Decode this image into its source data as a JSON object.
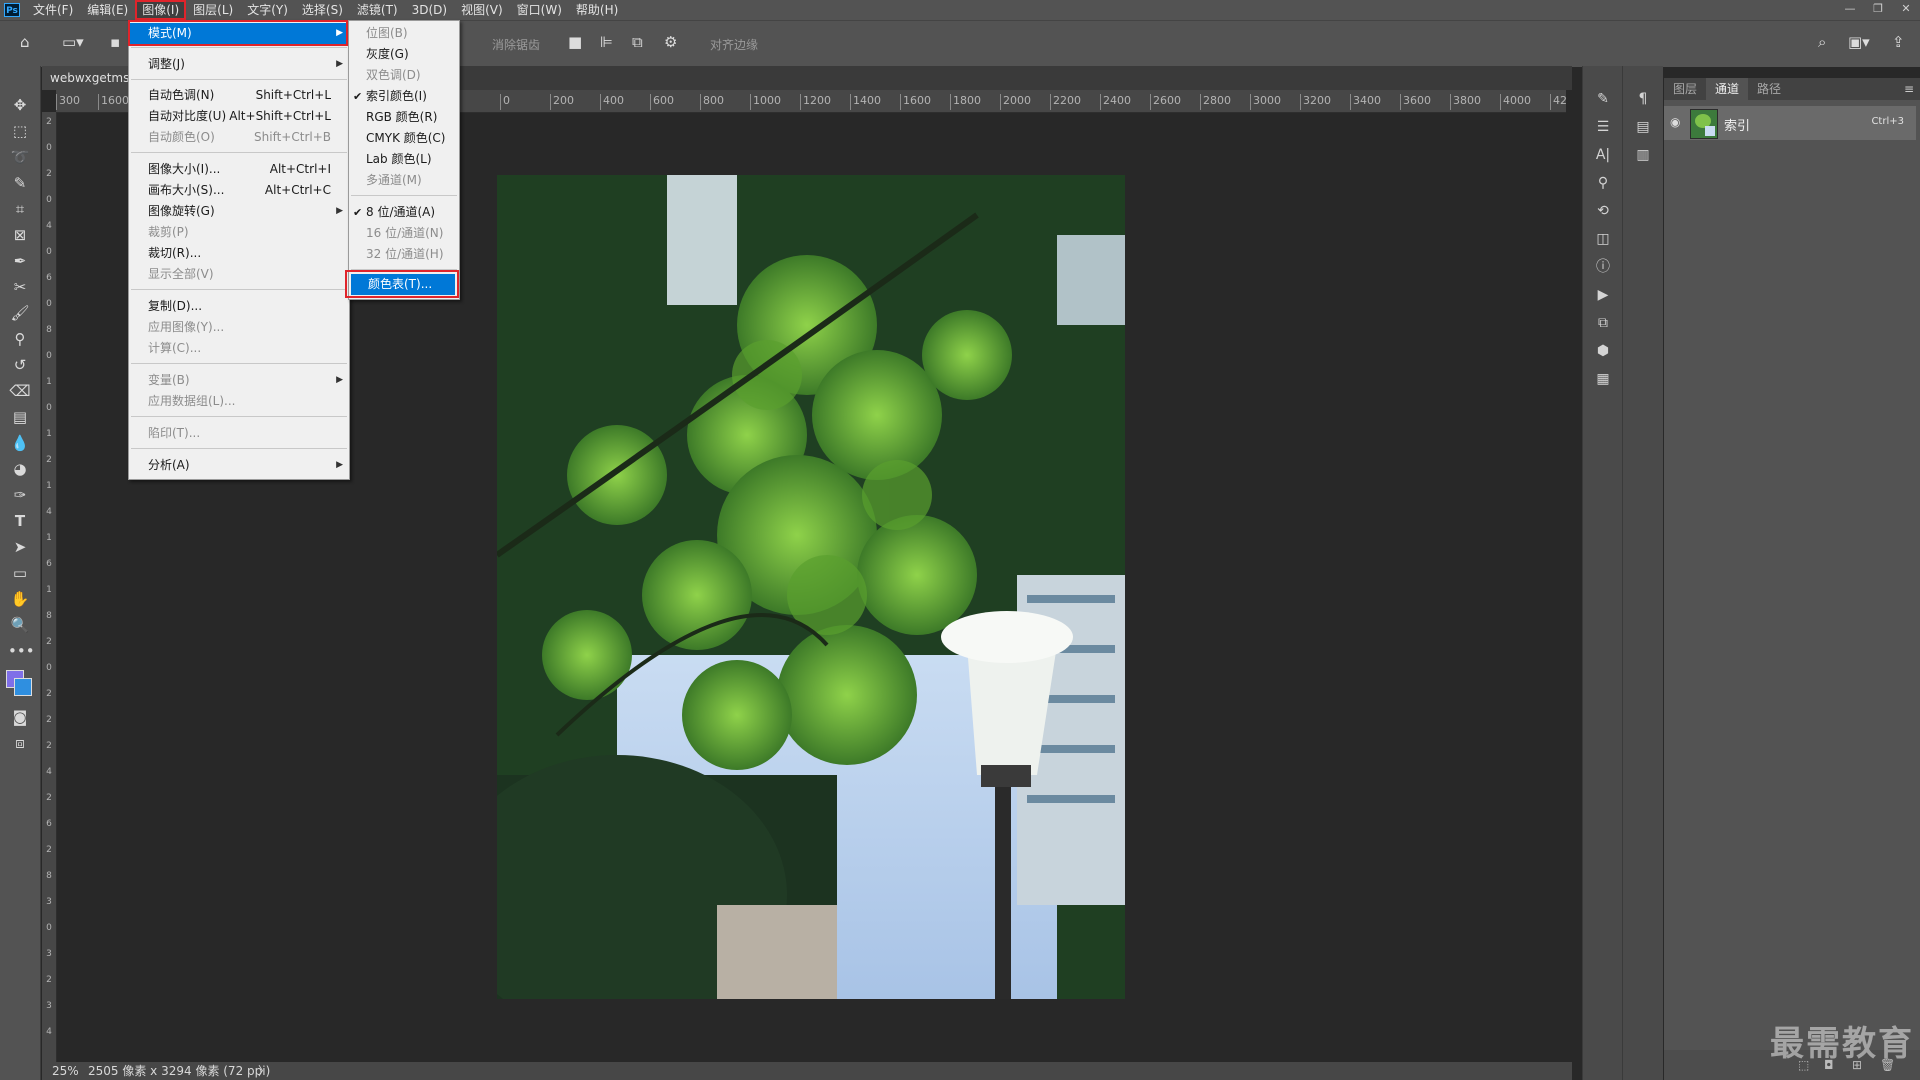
{
  "menubar": {
    "logo": "Ps",
    "items": [
      "文件(F)",
      "编辑(E)",
      "图像(I)",
      "图层(L)",
      "文字(Y)",
      "选择(S)",
      "滤镜(T)",
      "3D(D)",
      "视图(V)",
      "窗口(W)",
      "帮助(H)"
    ],
    "active": "图像(I)"
  },
  "window_controls": {
    "minimize": "—",
    "restore": "❐",
    "close": "✕"
  },
  "options_bar": {
    "antialias_label": "消除锯齿",
    "align_edges_label": "对齐边缘"
  },
  "document": {
    "tab_title": "webwxgetmsg",
    "ruler_ticks": [
      "300",
      "1600",
      "0",
      "200",
      "400",
      "600",
      "800",
      "1000",
      "1200",
      "1400",
      "1600",
      "1800",
      "2000",
      "2200",
      "2400",
      "2600",
      "2800",
      "3000",
      "3200",
      "3400",
      "3600",
      "3800",
      "4000",
      "42"
    ],
    "zoom": "25%",
    "dimensions": "2505 像素 x 3294 像素 (72 ppi)",
    "status_arrow": "〉"
  },
  "image_menu": {
    "items": [
      {
        "label": "模式(M)",
        "shortcut": "",
        "submenu": true,
        "disabled": false,
        "highlighted": true
      },
      {
        "label": "调整(J)",
        "shortcut": "",
        "submenu": true,
        "disabled": false
      },
      {
        "label": "自动色调(N)",
        "shortcut": "Shift+Ctrl+L",
        "disabled": false
      },
      {
        "label": "自动对比度(U)",
        "shortcut": "Alt+Shift+Ctrl+L",
        "disabled": false
      },
      {
        "label": "自动颜色(O)",
        "shortcut": "Shift+Ctrl+B",
        "disabled": true
      },
      {
        "label": "图像大小(I)...",
        "shortcut": "Alt+Ctrl+I",
        "disabled": false
      },
      {
        "label": "画布大小(S)...",
        "shortcut": "Alt+Ctrl+C",
        "disabled": false
      },
      {
        "label": "图像旋转(G)",
        "shortcut": "",
        "submenu": true,
        "disabled": false
      },
      {
        "label": "裁剪(P)",
        "shortcut": "",
        "disabled": true
      },
      {
        "label": "裁切(R)...",
        "shortcut": "",
        "disabled": false
      },
      {
        "label": "显示全部(V)",
        "shortcut": "",
        "disabled": true
      },
      {
        "label": "复制(D)...",
        "shortcut": "",
        "disabled": false
      },
      {
        "label": "应用图像(Y)...",
        "shortcut": "",
        "disabled": true
      },
      {
        "label": "计算(C)...",
        "shortcut": "",
        "disabled": true
      },
      {
        "label": "变量(B)",
        "shortcut": "",
        "submenu": true,
        "disabled": true
      },
      {
        "label": "应用数据组(L)...",
        "shortcut": "",
        "disabled": true
      },
      {
        "label": "陷印(T)...",
        "shortcut": "",
        "disabled": true
      },
      {
        "label": "分析(A)",
        "shortcut": "",
        "submenu": true,
        "disabled": false
      }
    ]
  },
  "mode_submenu": {
    "items": [
      {
        "label": "位图(B)",
        "checked": false,
        "disabled": true
      },
      {
        "label": "灰度(G)",
        "checked": false,
        "disabled": false
      },
      {
        "label": "双色调(D)",
        "checked": false,
        "disabled": true
      },
      {
        "label": "索引颜色(I)",
        "checked": true,
        "disabled": false
      },
      {
        "label": "RGB 颜色(R)",
        "checked": false,
        "disabled": false
      },
      {
        "label": "CMYK 颜色(C)",
        "checked": false,
        "disabled": false
      },
      {
        "label": "Lab 颜色(L)",
        "checked": false,
        "disabled": false
      },
      {
        "label": "多通道(M)",
        "checked": false,
        "disabled": true
      },
      {
        "label": "8 位/通道(A)",
        "checked": true,
        "disabled": false
      },
      {
        "label": "16 位/通道(N)",
        "checked": false,
        "disabled": true
      },
      {
        "label": "32 位/通道(H)",
        "checked": false,
        "disabled": true
      },
      {
        "label": "颜色表(T)...",
        "checked": false,
        "disabled": false,
        "highlighted": true
      }
    ],
    "check_glyph": "✔"
  },
  "channels_panel": {
    "tabs": [
      "图层",
      "通道",
      "路径"
    ],
    "selected_tab": "通道",
    "channel": {
      "name": "索引",
      "shortcut": "Ctrl+3"
    }
  },
  "watermark": "最需教育",
  "colors": {
    "highlight": "#0078d7",
    "callout_red": "#e0242b",
    "ui_bg": "#535353",
    "fg_swatch": "#7f6fe8",
    "bg_swatch": "#2f8fe0"
  },
  "icons": {
    "arrow_right": "▶",
    "eye": "◉"
  }
}
